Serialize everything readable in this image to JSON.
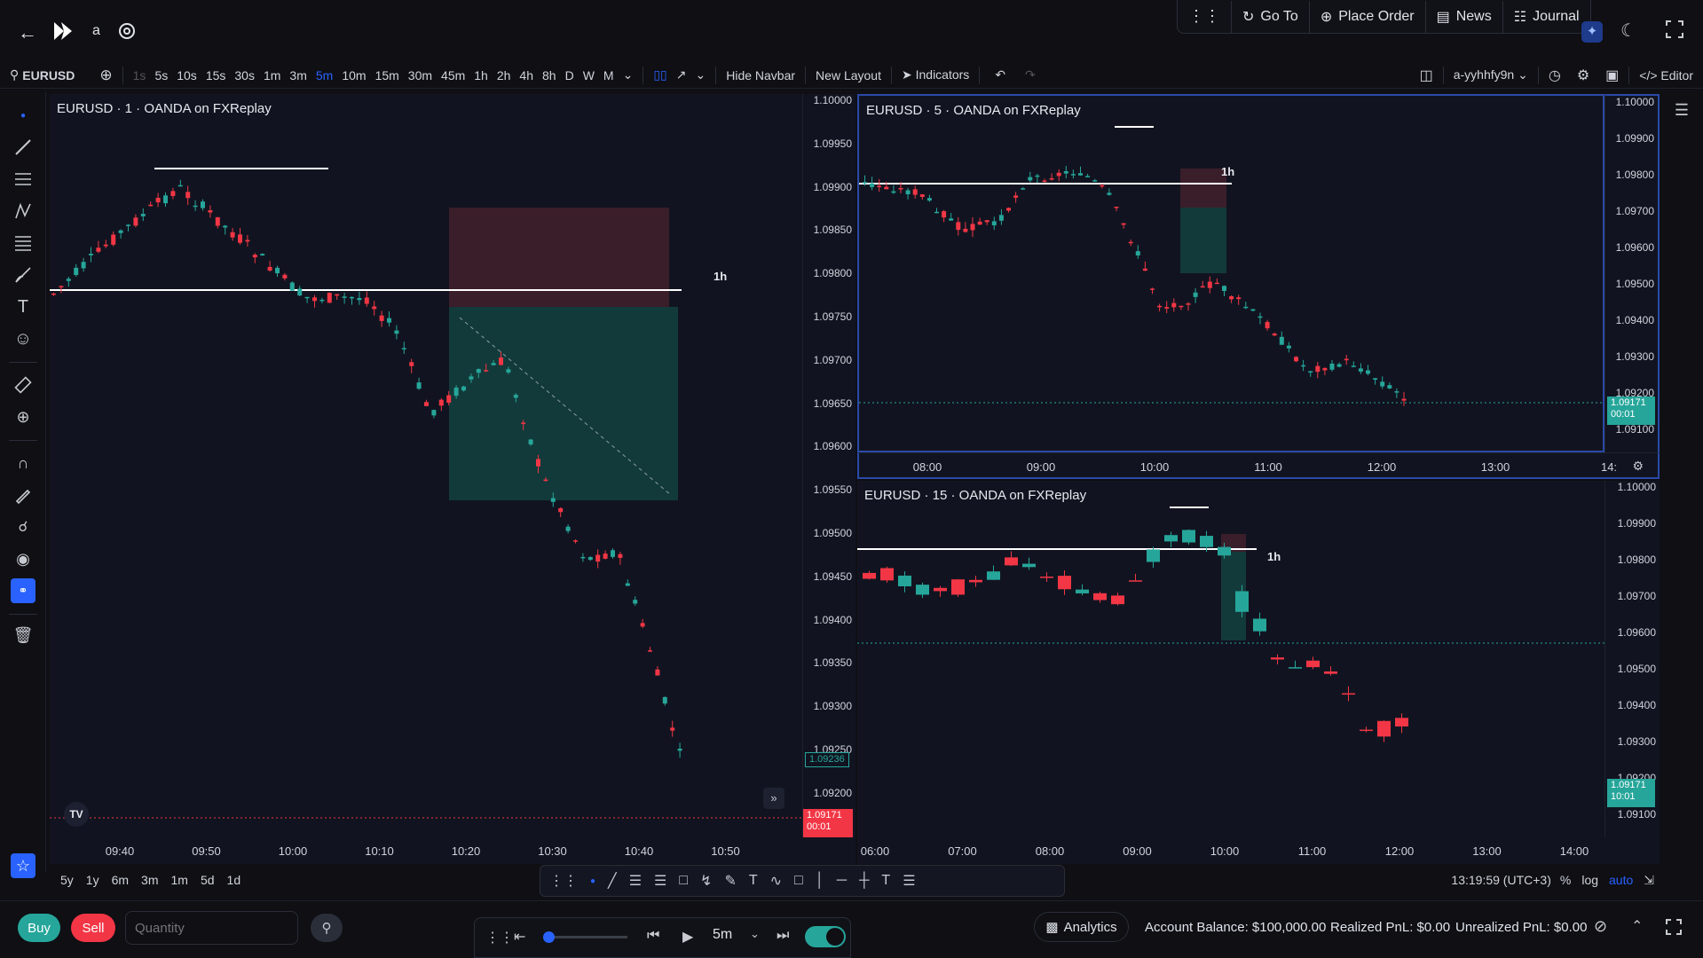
{
  "header": {
    "username": "a",
    "nav": {
      "goto": "Go To",
      "place_order": "Place Order",
      "news": "News",
      "journal": "Journal"
    }
  },
  "toolbar": {
    "symbol": "EURUSD",
    "timeframes": [
      "1s",
      "5s",
      "10s",
      "15s",
      "30s",
      "1m",
      "3m",
      "5m",
      "10m",
      "15m",
      "30m",
      "45m",
      "1h",
      "2h",
      "4h",
      "8h",
      "D",
      "W",
      "M"
    ],
    "active_timeframe": "5m",
    "hide_navbar": "Hide Navbar",
    "new_layout": "New Layout",
    "indicators": "Indicators",
    "layout_name": "a-yyhhfy9n",
    "editor": "Editor"
  },
  "pane_left": {
    "title": "EURUSD · 1 · OANDA on FXReplay",
    "prices": [
      "1.10000",
      "1.09950",
      "1.09900",
      "1.09850",
      "1.09800",
      "1.09750",
      "1.09700",
      "1.09650",
      "1.09600",
      "1.09550",
      "1.09500",
      "1.09450",
      "1.09400",
      "1.09350",
      "1.09300",
      "1.09250",
      "1.09200"
    ],
    "times": [
      "09:40",
      "09:50",
      "10:00",
      "10:10",
      "10:20",
      "10:30",
      "10:40",
      "10:50"
    ],
    "zone_label": "1h",
    "price_badge_green": "1.09236",
    "price_badge_red": "1.09171",
    "price_badge_red_time": "00:01"
  },
  "pane_tr": {
    "title": "EURUSD · 5 · OANDA on FXReplay",
    "prices": [
      "1.10000",
      "1.09900",
      "1.09800",
      "1.09700",
      "1.09600",
      "1.09500",
      "1.09400",
      "1.09300",
      "1.09200",
      "1.09100"
    ],
    "times": [
      "08:00",
      "09:00",
      "10:00",
      "11:00",
      "12:00",
      "13:00",
      "14:"
    ],
    "zone_label": "1h",
    "badge_price": "1.09171",
    "badge_time": "00:01"
  },
  "pane_br": {
    "title": "EURUSD · 15 · OANDA on FXReplay",
    "prices": [
      "1.10000",
      "1.09900",
      "1.09800",
      "1.09700",
      "1.09600",
      "1.09500",
      "1.09400",
      "1.09300",
      "1.09200",
      "1.09100"
    ],
    "times": [
      "06:00",
      "07:00",
      "08:00",
      "09:00",
      "10:00",
      "11:00",
      "12:00",
      "13:00",
      "14:00"
    ],
    "zone_label": "1h",
    "badge_price": "1.09171",
    "badge_time": "10:01"
  },
  "bottom": {
    "ranges": [
      "5y",
      "1y",
      "6m",
      "3m",
      "1m",
      "5d",
      "1d"
    ],
    "clock": "13:19:59 (UTC+3)",
    "percent": "%",
    "log": "log",
    "auto": "auto"
  },
  "footer": {
    "buy": "Buy",
    "sell": "Sell",
    "quantity_placeholder": "Quantity",
    "speed": "5m",
    "analytics": "Analytics",
    "account_balance": "Account Balance: $100,000.00",
    "realized_pnl": "Realized PnL: $0.00",
    "unrealized_pnl": "Unrealized PnL: $0.00"
  },
  "colors": {
    "up": "#26a69a",
    "down": "#f23645",
    "accent": "#2962ff"
  }
}
